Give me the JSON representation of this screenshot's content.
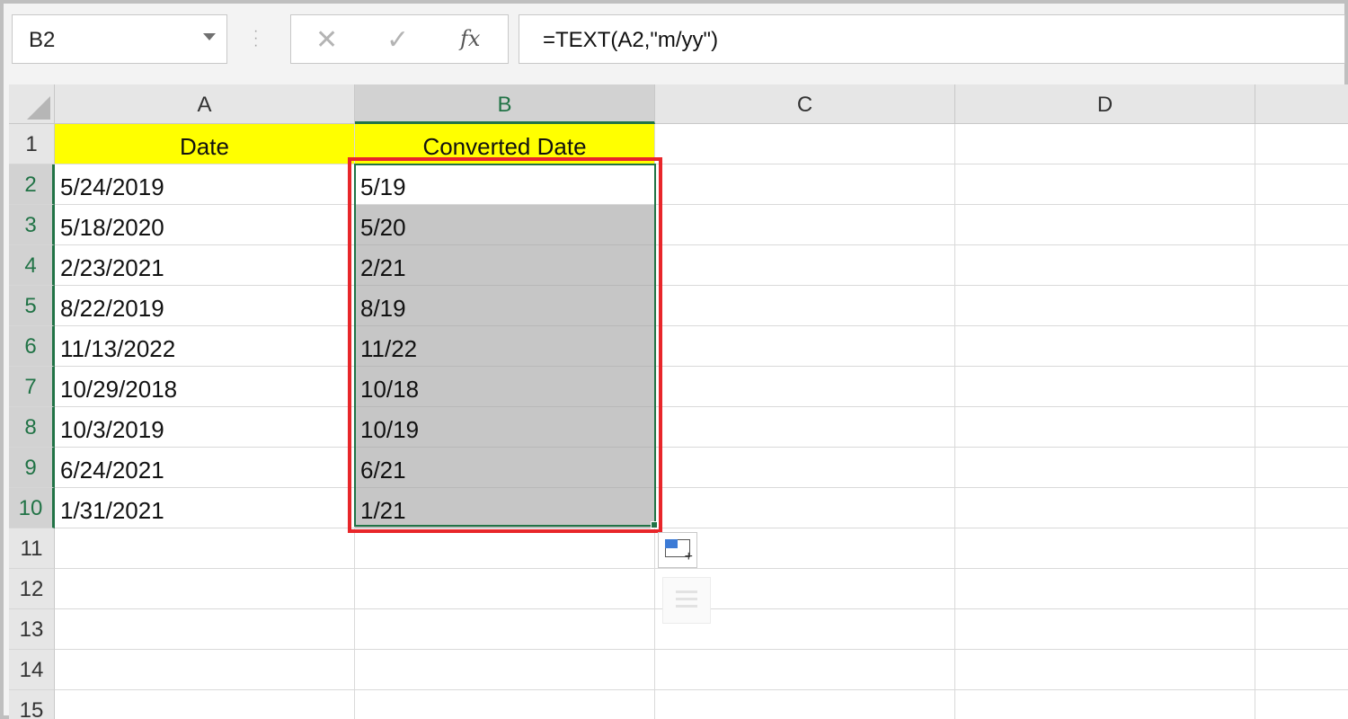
{
  "name_box": "B2",
  "formula": "=TEXT(A2,\"m/yy\")",
  "formula_buttons": {
    "cancel": "✕",
    "enter": "✓",
    "function": "fx"
  },
  "columns": [
    "A",
    "B",
    "C",
    "D"
  ],
  "rows": [
    "1",
    "2",
    "3",
    "4",
    "5",
    "6",
    "7",
    "8",
    "9",
    "10",
    "11",
    "12",
    "13",
    "14",
    "15"
  ],
  "header_row": {
    "a": "Date",
    "b": "Converted Date"
  },
  "data_rows": [
    {
      "a": "5/24/2019",
      "b": "5/19"
    },
    {
      "a": "5/18/2020",
      "b": "5/20"
    },
    {
      "a": "2/23/2021",
      "b": "2/21"
    },
    {
      "a": "8/22/2019",
      "b": "8/19"
    },
    {
      "a": "11/13/2022",
      "b": "11/22"
    },
    {
      "a": "10/29/2018",
      "b": "10/18"
    },
    {
      "a": "10/3/2019",
      "b": "10/19"
    },
    {
      "a": "6/24/2021",
      "b": "6/21"
    },
    {
      "a": "1/31/2021",
      "b": "1/21"
    }
  ],
  "colors": {
    "header_fill": "#ffff00",
    "selection_border": "#217346",
    "highlight_box": "#e8262a"
  },
  "icons": {
    "quick_analysis": "quick-analysis-icon",
    "flash_fill": "flash-fill-icon"
  }
}
